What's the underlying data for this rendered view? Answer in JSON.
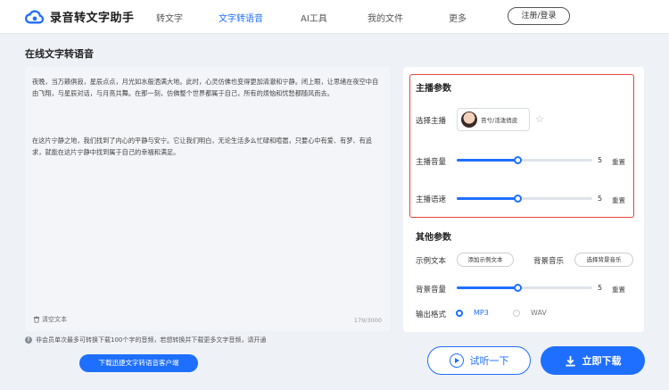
{
  "header": {
    "app_title": "录音转文字助手",
    "nav": [
      "转文字",
      "文字转语音",
      "AI工具",
      "我的文件",
      "更多"
    ],
    "active_nav": "文字转语音",
    "login_label": "注册/登录"
  },
  "page_title": "在线文字转语音",
  "editor": {
    "paragraph1": "夜晚，当万籁俱寂，星辰点点，月光如水般洒满大地。此时，心灵仿佛也变得更加清澈和宁静。闭上眼，让思绪在夜空中自由飞翔，与星辰对话，与月亮共舞。在那一刻，仿佛整个世界都属于自己，所有的烦恼和忧愁都随风而去。",
    "paragraph2": "在这片宁静之地，我们找到了内心的平静与安宁。它让我们明白，无论生活多么忙碌和喧嚣，只要心中有爱、有梦、有追求，就能在这片宁静中找到属于自己的幸福和满足。",
    "clear_label": "清空文本",
    "char_count": "179/3000"
  },
  "notice": "非会员单次最多可转换下载100个字的音频，若想转换并下载更多文字音频，请开通",
  "client_download_label": "下载迅捷文字转语音客户端",
  "anchor_params": {
    "title": "主播参数",
    "select_label": "选择主播",
    "voice_name": "苔兮/活泼俏皮",
    "volume_label": "主播音量",
    "volume_value": "5",
    "volume_level": 0.45,
    "speed_label": "主播语速",
    "speed_value": "5",
    "speed_level": 0.45,
    "reset_label": "重置"
  },
  "other_params": {
    "title": "其他参数",
    "sample_label": "示例文本",
    "add_sample_label": "添加示例文本",
    "bgm_label": "背景音乐",
    "choose_bgm_label": "选择背景音乐",
    "bg_volume_label": "背景音量",
    "bg_volume_value": "5",
    "bg_volume_level": 0.45,
    "reset_label": "重置",
    "format_label": "输出格式",
    "formats": [
      "MP3",
      "WAV"
    ],
    "selected_format": "MP3"
  },
  "actions": {
    "listen_label": "试听一下",
    "download_label": "立即下载"
  },
  "colors": {
    "accent": "#1e6fff",
    "highlight_border": "#e4463b"
  }
}
